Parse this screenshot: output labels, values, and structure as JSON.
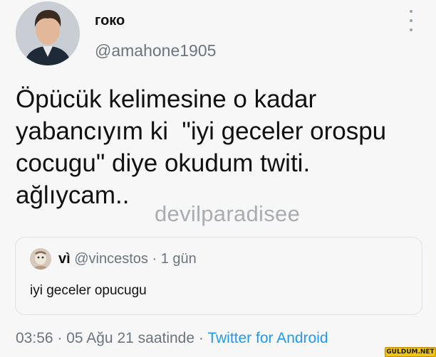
{
  "author": {
    "display_name": "гоко",
    "handle": "@amahone1905",
    "avatar_icon": "profile-photo-man-icon"
  },
  "tweet": {
    "lines": [
      "Öpücük kelimesine o kadar",
      "yabancıyım ki  \"iyi geceler orospu",
      "cocugu\" diye okudum twiti.",
      "ağlıycam.."
    ]
  },
  "watermark": "devilparadisee",
  "quoted_tweet": {
    "display_name": "vì",
    "meta": " @vincestos · 1 gün",
    "text": "iyi geceler opucugu",
    "avatar_icon": "profile-photo-icon"
  },
  "footer": {
    "timestamp": "03:56 · 05 Ağu 21 saatinde · ",
    "source": "Twitter for Android"
  },
  "site_logo": "GULDUM.NET",
  "colors": {
    "link": "#1d9bf0",
    "muted": "#6b7580",
    "background": "#f7f7f7"
  }
}
